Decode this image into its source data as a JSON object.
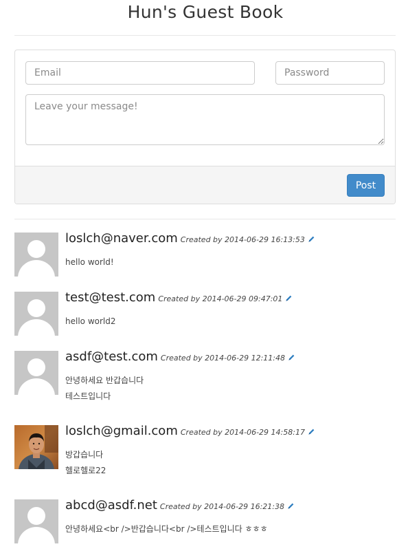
{
  "page": {
    "title": "Hun's Guest Book"
  },
  "form": {
    "email_placeholder": "Email",
    "password_placeholder": "Password",
    "message_placeholder": "Leave your message!",
    "post_label": "Post"
  },
  "entries": [
    {
      "email": "loslch@naver.com",
      "created": "Created by 2014-06-29 16:13:53",
      "lines": [
        "hello world!"
      ],
      "avatar": "default-avatar-icon"
    },
    {
      "email": "test@test.com",
      "created": "Created by 2014-06-29 09:47:01",
      "lines": [
        "hello world2"
      ],
      "avatar": "default-avatar-icon"
    },
    {
      "email": "asdf@test.com",
      "created": "Created by 2014-06-29 12:11:48",
      "lines": [
        "안녕하세요 반갑습니다",
        "테스트입니다"
      ],
      "avatar": "default-avatar-icon"
    },
    {
      "email": "loslch@gmail.com",
      "created": "Created by 2014-06-29 14:58:17",
      "lines": [
        "방갑습니다",
        "헬로헬로22"
      ],
      "avatar": "user-photo"
    },
    {
      "email": "abcd@asdf.net",
      "created": "Created by 2014-06-29 16:21:38",
      "lines": [
        "안녕하세요<br />반갑습니다<br />테스트입니다 ㅎㅎㅎ"
      ],
      "avatar": "default-avatar-icon"
    }
  ],
  "colors": {
    "accent": "#428bca",
    "avatar_bg": "#c6c6c6",
    "panel_footer_bg": "#f5f5f5"
  }
}
